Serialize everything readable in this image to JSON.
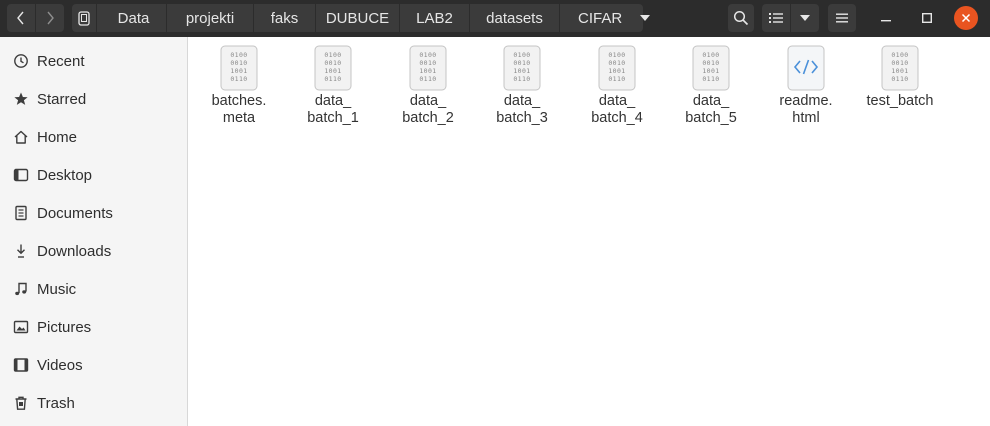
{
  "toolbar": {
    "breadcrumbs": [
      "Data",
      "projekti",
      "faks",
      "DUBUCE",
      "LAB2",
      "datasets",
      "CIFAR"
    ]
  },
  "sidebar": {
    "items": [
      {
        "label": "Recent",
        "icon": "clock-icon"
      },
      {
        "label": "Starred",
        "icon": "star-icon"
      },
      {
        "label": "Home",
        "icon": "home-icon"
      },
      {
        "label": "Desktop",
        "icon": "desktop-icon"
      },
      {
        "label": "Documents",
        "icon": "document-icon"
      },
      {
        "label": "Downloads",
        "icon": "download-icon"
      },
      {
        "label": "Music",
        "icon": "music-icon"
      },
      {
        "label": "Pictures",
        "icon": "picture-icon"
      },
      {
        "label": "Videos",
        "icon": "video-icon"
      },
      {
        "label": "Trash",
        "icon": "trash-icon"
      }
    ]
  },
  "files": [
    {
      "line1": "batches.",
      "line2": "meta",
      "icon": "binary-file-icon"
    },
    {
      "line1": "data_",
      "line2": "batch_1",
      "icon": "binary-file-icon"
    },
    {
      "line1": "data_",
      "line2": "batch_2",
      "icon": "binary-file-icon"
    },
    {
      "line1": "data_",
      "line2": "batch_3",
      "icon": "binary-file-icon"
    },
    {
      "line1": "data_",
      "line2": "batch_4",
      "icon": "binary-file-icon"
    },
    {
      "line1": "data_",
      "line2": "batch_5",
      "icon": "binary-file-icon"
    },
    {
      "line1": "readme.",
      "line2": "html",
      "icon": "html-file-icon"
    },
    {
      "line1": "test_batch",
      "line2": "",
      "icon": "binary-file-icon"
    }
  ],
  "binary_glyph": [
    "0100",
    "0010",
    "1001",
    "0110"
  ],
  "colors": {
    "headerbar": "#2c2c2c",
    "button": "#3b3b3b",
    "close_button": "#e95420",
    "sidebar": "#f5f5f5",
    "html_icon_accent": "#4a90d9"
  }
}
